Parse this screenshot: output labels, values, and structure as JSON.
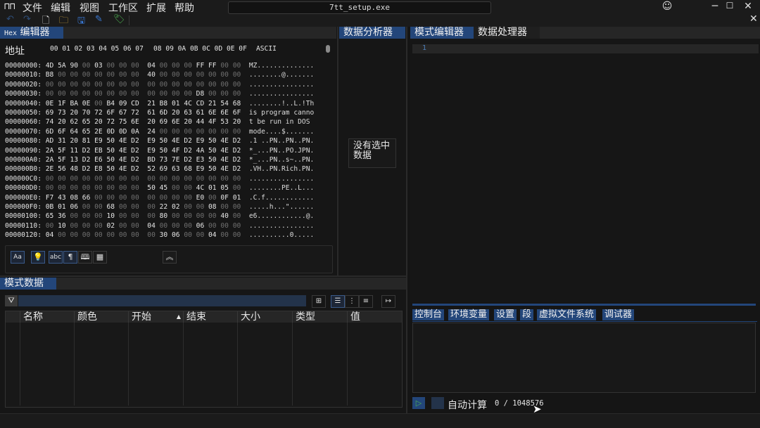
{
  "menubar": {
    "items": [
      "文件",
      "编辑",
      "视图",
      "工作区",
      "扩展",
      "帮助"
    ]
  },
  "window": {
    "title": "7tt_setup.exe"
  },
  "hex_editor": {
    "tab_prefix": "Hex",
    "tab_label": "编辑器",
    "address_header": "地址",
    "byte_headers_1": "00 01 02 03 04 05 06 07",
    "byte_headers_2": "08 09 0A 0B 0C 0D 0E 0F",
    "ascii_header": "ASCII",
    "rows": [
      {
        "addr": "00000000:",
        "bytes": [
          "4D",
          "5A",
          "90",
          "00",
          "03",
          "00",
          "00",
          "00",
          "04",
          "00",
          "00",
          "00",
          "FF",
          "FF",
          "00",
          "00"
        ],
        "ascii": "MZ.............."
      },
      {
        "addr": "00000010:",
        "bytes": [
          "B8",
          "00",
          "00",
          "00",
          "00",
          "00",
          "00",
          "00",
          "40",
          "00",
          "00",
          "00",
          "00",
          "00",
          "00",
          "00"
        ],
        "ascii": "........@......."
      },
      {
        "addr": "00000020:",
        "bytes": [
          "00",
          "00",
          "00",
          "00",
          "00",
          "00",
          "00",
          "00",
          "00",
          "00",
          "00",
          "00",
          "00",
          "00",
          "00",
          "00"
        ],
        "ascii": "................"
      },
      {
        "addr": "00000030:",
        "bytes": [
          "00",
          "00",
          "00",
          "00",
          "00",
          "00",
          "00",
          "00",
          "00",
          "00",
          "00",
          "00",
          "D8",
          "00",
          "00",
          "00"
        ],
        "ascii": "................"
      },
      {
        "addr": "00000040:",
        "bytes": [
          "0E",
          "1F",
          "BA",
          "0E",
          "00",
          "B4",
          "09",
          "CD",
          "21",
          "B8",
          "01",
          "4C",
          "CD",
          "21",
          "54",
          "68"
        ],
        "ascii": "........!..L.!Th"
      },
      {
        "addr": "00000050:",
        "bytes": [
          "69",
          "73",
          "20",
          "70",
          "72",
          "6F",
          "67",
          "72",
          "61",
          "6D",
          "20",
          "63",
          "61",
          "6E",
          "6E",
          "6F"
        ],
        "ascii": "is program canno"
      },
      {
        "addr": "00000060:",
        "bytes": [
          "74",
          "20",
          "62",
          "65",
          "20",
          "72",
          "75",
          "6E",
          "20",
          "69",
          "6E",
          "20",
          "44",
          "4F",
          "53",
          "20"
        ],
        "ascii": "t be run in DOS "
      },
      {
        "addr": "00000070:",
        "bytes": [
          "6D",
          "6F",
          "64",
          "65",
          "2E",
          "0D",
          "0D",
          "0A",
          "24",
          "00",
          "00",
          "00",
          "00",
          "00",
          "00",
          "00"
        ],
        "ascii": "mode....$......."
      },
      {
        "addr": "00000080:",
        "bytes": [
          "AD",
          "31",
          "20",
          "81",
          "E9",
          "50",
          "4E",
          "D2",
          "E9",
          "50",
          "4E",
          "D2",
          "E9",
          "50",
          "4E",
          "D2"
        ],
        "ascii": ".1 ..PN..PN..PN."
      },
      {
        "addr": "00000090:",
        "bytes": [
          "2A",
          "5F",
          "11",
          "D2",
          "EB",
          "50",
          "4E",
          "D2",
          "E9",
          "50",
          "4F",
          "D2",
          "4A",
          "50",
          "4E",
          "D2"
        ],
        "ascii": "*_...PN..PO.JPN."
      },
      {
        "addr": "000000A0:",
        "bytes": [
          "2A",
          "5F",
          "13",
          "D2",
          "E6",
          "50",
          "4E",
          "D2",
          "BD",
          "73",
          "7E",
          "D2",
          "E3",
          "50",
          "4E",
          "D2"
        ],
        "ascii": "*_...PN..s~..PN."
      },
      {
        "addr": "000000B0:",
        "bytes": [
          "2E",
          "56",
          "48",
          "D2",
          "E8",
          "50",
          "4E",
          "D2",
          "52",
          "69",
          "63",
          "68",
          "E9",
          "50",
          "4E",
          "D2"
        ],
        "ascii": ".VH..PN.Rich.PN."
      },
      {
        "addr": "000000C0:",
        "bytes": [
          "00",
          "00",
          "00",
          "00",
          "00",
          "00",
          "00",
          "00",
          "00",
          "00",
          "00",
          "00",
          "00",
          "00",
          "00",
          "00"
        ],
        "ascii": "................"
      },
      {
        "addr": "000000D0:",
        "bytes": [
          "00",
          "00",
          "00",
          "00",
          "00",
          "00",
          "00",
          "00",
          "50",
          "45",
          "00",
          "00",
          "4C",
          "01",
          "05",
          "00"
        ],
        "ascii": "........PE..L..."
      },
      {
        "addr": "000000E0:",
        "bytes": [
          "F7",
          "43",
          "08",
          "66",
          "00",
          "00",
          "00",
          "00",
          "00",
          "00",
          "00",
          "00",
          "E0",
          "00",
          "0F",
          "01"
        ],
        "ascii": ".C.f............"
      },
      {
        "addr": "000000F0:",
        "bytes": [
          "0B",
          "01",
          "06",
          "00",
          "00",
          "68",
          "00",
          "00",
          "00",
          "22",
          "02",
          "00",
          "00",
          "08",
          "00",
          "00"
        ],
        "ascii": ".....h...\"......"
      },
      {
        "addr": "00000100:",
        "bytes": [
          "65",
          "36",
          "00",
          "00",
          "00",
          "10",
          "00",
          "00",
          "00",
          "80",
          "00",
          "00",
          "00",
          "00",
          "40",
          "00"
        ],
        "ascii": "e6............@."
      },
      {
        "addr": "00000110:",
        "bytes": [
          "00",
          "10",
          "00",
          "00",
          "00",
          "02",
          "00",
          "00",
          "04",
          "00",
          "00",
          "00",
          "06",
          "00",
          "00",
          "00"
        ],
        "ascii": "................"
      },
      {
        "addr": "00000120:",
        "bytes": [
          "04",
          "00",
          "00",
          "00",
          "00",
          "00",
          "00",
          "00",
          "00",
          "30",
          "06",
          "00",
          "00",
          "04",
          "00",
          "00"
        ],
        "ascii": "..........0....."
      }
    ],
    "toolbar_icons": [
      "case-icon",
      "lightbulb-icon",
      "abc-icon",
      "pilcrow-icon",
      "book-icon",
      "table-icon"
    ],
    "toolbar_labels": {
      "case": "Aa",
      "abc": "abc",
      "pilcrow": "¶"
    },
    "collapse_icon": "chevron-up-double-icon"
  },
  "data_inspector": {
    "tab_label": "数据分析器",
    "empty_text": "没有选中数据"
  },
  "pattern_editor": {
    "tabs": [
      "模式编辑器",
      "数据处理器"
    ],
    "line_number": "1",
    "bottom_tabs": [
      "控制台",
      "环境变量",
      "设置",
      "段",
      "虚拟文件系统",
      "调试器"
    ],
    "auto_eval_label": "自动计算",
    "progress_text": "0 / 1048576"
  },
  "pattern_data": {
    "tab_label": "模式数据",
    "columns": [
      "名称",
      "颜色",
      "开始",
      "结束",
      "大小",
      "类型",
      "值"
    ],
    "sort_indicator": "▲"
  },
  "colors": {
    "accent": "#23467a",
    "background": "#151515",
    "panel": "#1e1e1e",
    "zero_byte": "#707070"
  }
}
